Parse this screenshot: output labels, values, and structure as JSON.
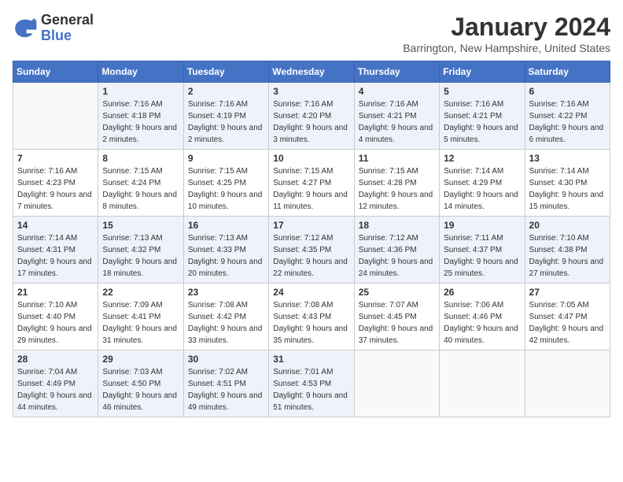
{
  "logo": {
    "general": "General",
    "blue": "Blue"
  },
  "title": "January 2024",
  "subtitle": "Barrington, New Hampshire, United States",
  "days_of_week": [
    "Sunday",
    "Monday",
    "Tuesday",
    "Wednesday",
    "Thursday",
    "Friday",
    "Saturday"
  ],
  "weeks": [
    [
      {
        "day": "",
        "sunrise": "",
        "sunset": "",
        "daylight": ""
      },
      {
        "day": "1",
        "sunrise": "Sunrise: 7:16 AM",
        "sunset": "Sunset: 4:18 PM",
        "daylight": "Daylight: 9 hours and 2 minutes."
      },
      {
        "day": "2",
        "sunrise": "Sunrise: 7:16 AM",
        "sunset": "Sunset: 4:19 PM",
        "daylight": "Daylight: 9 hours and 2 minutes."
      },
      {
        "day": "3",
        "sunrise": "Sunrise: 7:16 AM",
        "sunset": "Sunset: 4:20 PM",
        "daylight": "Daylight: 9 hours and 3 minutes."
      },
      {
        "day": "4",
        "sunrise": "Sunrise: 7:16 AM",
        "sunset": "Sunset: 4:21 PM",
        "daylight": "Daylight: 9 hours and 4 minutes."
      },
      {
        "day": "5",
        "sunrise": "Sunrise: 7:16 AM",
        "sunset": "Sunset: 4:21 PM",
        "daylight": "Daylight: 9 hours and 5 minutes."
      },
      {
        "day": "6",
        "sunrise": "Sunrise: 7:16 AM",
        "sunset": "Sunset: 4:22 PM",
        "daylight": "Daylight: 9 hours and 6 minutes."
      }
    ],
    [
      {
        "day": "7",
        "sunrise": "Sunrise: 7:16 AM",
        "sunset": "Sunset: 4:23 PM",
        "daylight": "Daylight: 9 hours and 7 minutes."
      },
      {
        "day": "8",
        "sunrise": "Sunrise: 7:15 AM",
        "sunset": "Sunset: 4:24 PM",
        "daylight": "Daylight: 9 hours and 8 minutes."
      },
      {
        "day": "9",
        "sunrise": "Sunrise: 7:15 AM",
        "sunset": "Sunset: 4:25 PM",
        "daylight": "Daylight: 9 hours and 10 minutes."
      },
      {
        "day": "10",
        "sunrise": "Sunrise: 7:15 AM",
        "sunset": "Sunset: 4:27 PM",
        "daylight": "Daylight: 9 hours and 11 minutes."
      },
      {
        "day": "11",
        "sunrise": "Sunrise: 7:15 AM",
        "sunset": "Sunset: 4:28 PM",
        "daylight": "Daylight: 9 hours and 12 minutes."
      },
      {
        "day": "12",
        "sunrise": "Sunrise: 7:14 AM",
        "sunset": "Sunset: 4:29 PM",
        "daylight": "Daylight: 9 hours and 14 minutes."
      },
      {
        "day": "13",
        "sunrise": "Sunrise: 7:14 AM",
        "sunset": "Sunset: 4:30 PM",
        "daylight": "Daylight: 9 hours and 15 minutes."
      }
    ],
    [
      {
        "day": "14",
        "sunrise": "Sunrise: 7:14 AM",
        "sunset": "Sunset: 4:31 PM",
        "daylight": "Daylight: 9 hours and 17 minutes."
      },
      {
        "day": "15",
        "sunrise": "Sunrise: 7:13 AM",
        "sunset": "Sunset: 4:32 PM",
        "daylight": "Daylight: 9 hours and 18 minutes."
      },
      {
        "day": "16",
        "sunrise": "Sunrise: 7:13 AM",
        "sunset": "Sunset: 4:33 PM",
        "daylight": "Daylight: 9 hours and 20 minutes."
      },
      {
        "day": "17",
        "sunrise": "Sunrise: 7:12 AM",
        "sunset": "Sunset: 4:35 PM",
        "daylight": "Daylight: 9 hours and 22 minutes."
      },
      {
        "day": "18",
        "sunrise": "Sunrise: 7:12 AM",
        "sunset": "Sunset: 4:36 PM",
        "daylight": "Daylight: 9 hours and 24 minutes."
      },
      {
        "day": "19",
        "sunrise": "Sunrise: 7:11 AM",
        "sunset": "Sunset: 4:37 PM",
        "daylight": "Daylight: 9 hours and 25 minutes."
      },
      {
        "day": "20",
        "sunrise": "Sunrise: 7:10 AM",
        "sunset": "Sunset: 4:38 PM",
        "daylight": "Daylight: 9 hours and 27 minutes."
      }
    ],
    [
      {
        "day": "21",
        "sunrise": "Sunrise: 7:10 AM",
        "sunset": "Sunset: 4:40 PM",
        "daylight": "Daylight: 9 hours and 29 minutes."
      },
      {
        "day": "22",
        "sunrise": "Sunrise: 7:09 AM",
        "sunset": "Sunset: 4:41 PM",
        "daylight": "Daylight: 9 hours and 31 minutes."
      },
      {
        "day": "23",
        "sunrise": "Sunrise: 7:08 AM",
        "sunset": "Sunset: 4:42 PM",
        "daylight": "Daylight: 9 hours and 33 minutes."
      },
      {
        "day": "24",
        "sunrise": "Sunrise: 7:08 AM",
        "sunset": "Sunset: 4:43 PM",
        "daylight": "Daylight: 9 hours and 35 minutes."
      },
      {
        "day": "25",
        "sunrise": "Sunrise: 7:07 AM",
        "sunset": "Sunset: 4:45 PM",
        "daylight": "Daylight: 9 hours and 37 minutes."
      },
      {
        "day": "26",
        "sunrise": "Sunrise: 7:06 AM",
        "sunset": "Sunset: 4:46 PM",
        "daylight": "Daylight: 9 hours and 40 minutes."
      },
      {
        "day": "27",
        "sunrise": "Sunrise: 7:05 AM",
        "sunset": "Sunset: 4:47 PM",
        "daylight": "Daylight: 9 hours and 42 minutes."
      }
    ],
    [
      {
        "day": "28",
        "sunrise": "Sunrise: 7:04 AM",
        "sunset": "Sunset: 4:49 PM",
        "daylight": "Daylight: 9 hours and 44 minutes."
      },
      {
        "day": "29",
        "sunrise": "Sunrise: 7:03 AM",
        "sunset": "Sunset: 4:50 PM",
        "daylight": "Daylight: 9 hours and 46 minutes."
      },
      {
        "day": "30",
        "sunrise": "Sunrise: 7:02 AM",
        "sunset": "Sunset: 4:51 PM",
        "daylight": "Daylight: 9 hours and 49 minutes."
      },
      {
        "day": "31",
        "sunrise": "Sunrise: 7:01 AM",
        "sunset": "Sunset: 4:53 PM",
        "daylight": "Daylight: 9 hours and 51 minutes."
      },
      {
        "day": "",
        "sunrise": "",
        "sunset": "",
        "daylight": ""
      },
      {
        "day": "",
        "sunrise": "",
        "sunset": "",
        "daylight": ""
      },
      {
        "day": "",
        "sunrise": "",
        "sunset": "",
        "daylight": ""
      }
    ]
  ]
}
